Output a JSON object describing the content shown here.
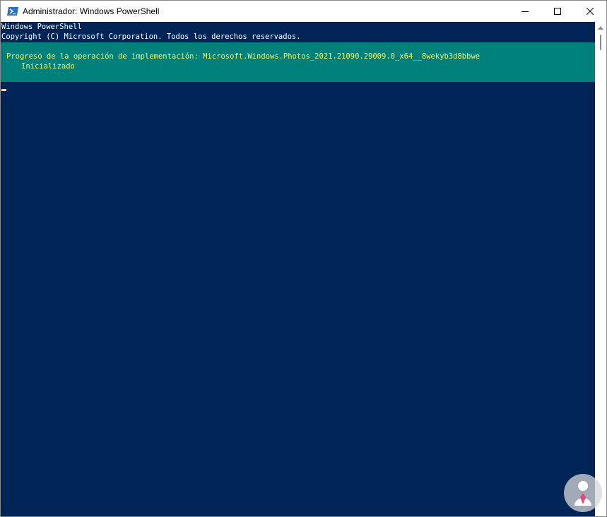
{
  "window": {
    "title": "Administrador: Windows PowerShell",
    "app_icon": "powershell-icon"
  },
  "caption_buttons": {
    "minimize_icon": "minimize-icon",
    "maximize_icon": "maximize-icon",
    "close_icon": "close-icon"
  },
  "console": {
    "lines": [
      "Windows PowerShell",
      "Copyright (C) Microsoft Corporation. Todos los derechos reservados."
    ],
    "progress": {
      "activity": "Progreso de la operación de implementación: Microsoft.Windows.Photos_2021.21090.29009.0_x64__8wekyb3d8bbwe",
      "status": "Inicializado"
    }
  },
  "colors": {
    "console_background": "#012456",
    "progress_background": "#00807a",
    "progress_text": "#f9f35a",
    "console_text": "#ffffff"
  },
  "watermark_icon": "person-watermark-icon"
}
